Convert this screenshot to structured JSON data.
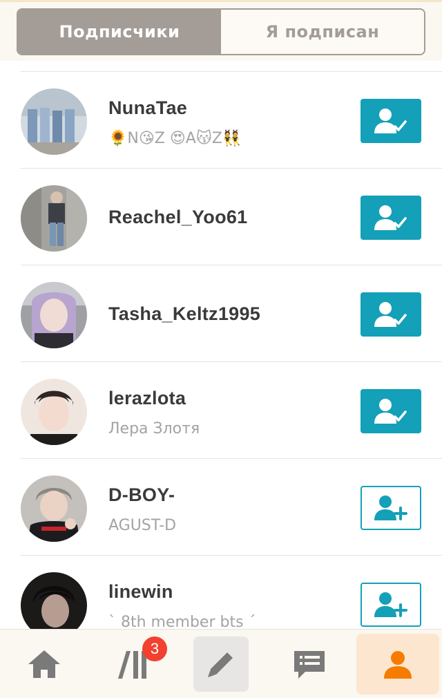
{
  "tabs": {
    "followers": "Подписчики",
    "following": "Я подписан"
  },
  "users": [
    {
      "name": "NunaTae",
      "subtitle": "🌻N😘Z 😍A😽Z👯",
      "status": "following",
      "avatar_colors": [
        "#8fa9c9",
        "#c9d4de"
      ]
    },
    {
      "name": "Reachel_Yoo61",
      "subtitle": "",
      "status": "following",
      "avatar_colors": [
        "#9b9a95",
        "#48505d"
      ]
    },
    {
      "name": "Tasha_Keltz1995",
      "subtitle": "",
      "status": "following",
      "avatar_colors": [
        "#c7b4d8",
        "#3e3b47"
      ]
    },
    {
      "name": "lerazlota",
      "subtitle": "Лера Злотя",
      "status": "following",
      "avatar_colors": [
        "#f1e4dc",
        "#2b2626"
      ]
    },
    {
      "name": "D-BOY-",
      "subtitle": "AGUST-D",
      "status": "not-following",
      "avatar_colors": [
        "#c9c5c1",
        "#1f1f22"
      ]
    },
    {
      "name": "linewin",
      "subtitle": "` 8th member bts ´",
      "status": "not-following",
      "avatar_colors": [
        "#3b3535",
        "#141213"
      ]
    }
  ],
  "nav": {
    "items": [
      "home-icon",
      "feed-icon",
      "compose-icon",
      "messages-icon",
      "profile-icon"
    ],
    "feed_badge": "3",
    "active": "profile"
  },
  "colors": {
    "accent": "#14a0b8",
    "tab_active_bg": "#a39c97",
    "badge": "#f2412f",
    "nav_active": "#f57c00",
    "nav_inactive": "#7a7a7a"
  }
}
